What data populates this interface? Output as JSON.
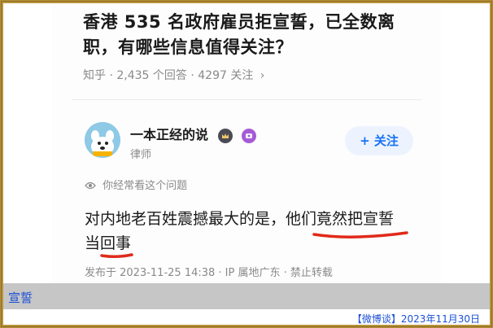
{
  "question": {
    "title": "香港 535 名政府雇员拒宣誓，已全数离职，有哪些信息值得关注？"
  },
  "meta": {
    "source": "知乎",
    "answers": "2,435 个回答",
    "followers": "4297 关注",
    "chevron": "›"
  },
  "author": {
    "name": "一本正经的说",
    "role": "律师",
    "avatar_icon": "dog-avatar-icon",
    "badge_icons": [
      "crown-badge-icon",
      "purple-badge-icon"
    ]
  },
  "follow_button": {
    "label": "+ 关注",
    "color": "#1772f6"
  },
  "seen_hint": {
    "text": "你经常看这个问题",
    "icon": "eye-icon"
  },
  "answer": {
    "part1": "对内地老百姓震撼最大的是，",
    "part2": "他们竟然把宣誓",
    "part3": "当",
    "part4": "回事",
    "underline_color": "#e02a1a"
  },
  "publish": {
    "text": "发布于 2023-11-25 14:38 · IP 属地广东 · 禁止转载"
  },
  "tag": {
    "label": "宣誓",
    "color": "#1a4fd6"
  },
  "footer": {
    "text": "【微博谈】2023年11月30日"
  },
  "colors": {
    "frame": "#b8933a",
    "tagbar": "#c6c6c6"
  }
}
